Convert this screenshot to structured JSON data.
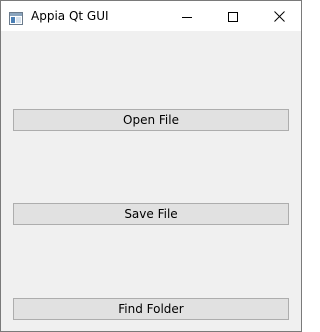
{
  "window": {
    "title": "Appia Qt GUI"
  },
  "titlebar": {
    "icons": [
      "app-window-icon",
      "minimize-icon",
      "maximize-icon",
      "close-icon"
    ]
  },
  "buttons": {
    "open_file": "Open File",
    "save_file": "Save File",
    "find_folder": "Find Folder"
  },
  "colors": {
    "window_background": "#f0f0f0",
    "titlebar_background": "#ffffff",
    "button_face": "#e1e1e1",
    "button_border": "#adadad"
  }
}
